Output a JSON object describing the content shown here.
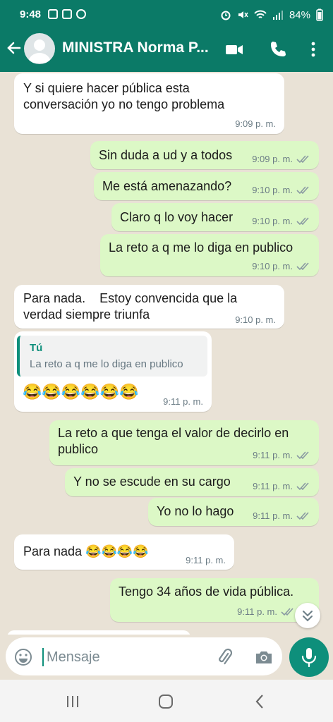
{
  "status_bar": {
    "time": "9:48",
    "battery": "84%"
  },
  "header": {
    "contact_name": "MINISTRA Norma P..."
  },
  "messages": [
    {
      "direction": "in",
      "text": "Y si quiere hacer pública esta conversación yo no tengo problema",
      "time": "9:09 p. m."
    },
    {
      "direction": "out",
      "text": "Sin duda a ud y a todos",
      "time": "9:09 p. m."
    },
    {
      "direction": "out",
      "text": "Me está amenazando?",
      "time": "9:10 p. m."
    },
    {
      "direction": "out",
      "text": "Claro q lo voy hacer",
      "time": "9:10 p. m."
    },
    {
      "direction": "out",
      "text": "La reto a q me lo diga en publico",
      "time": "9:10 p. m."
    },
    {
      "direction": "in",
      "text": "Para nada.    Estoy convencida que la verdad siempre triunfa",
      "time": "9:10 p. m."
    },
    {
      "direction": "in",
      "quote_author": "Tú",
      "quote_text": "La reto a q me lo diga en publico",
      "text": "😂😂😂😂😂😂",
      "time": "9:11 p. m."
    },
    {
      "direction": "out",
      "text": "La reto a que tenga el valor de decirlo en publico",
      "time": "9:11 p. m."
    },
    {
      "direction": "out",
      "text": "Y no se escude en su cargo",
      "time": "9:11 p. m."
    },
    {
      "direction": "out",
      "text": "Yo no lo hago",
      "time": "9:11 p. m."
    },
    {
      "direction": "in",
      "text": "Para nada 😂😂😂😂",
      "time": "9:11 p. m."
    },
    {
      "direction": "out",
      "text": "Tengo 34 años de vida pública.",
      "time": "9:11 p. m."
    }
  ],
  "composer": {
    "placeholder": "Mensaje"
  },
  "icons": {
    "back": "arrow-left-icon",
    "video": "video-call-icon",
    "call": "phone-icon",
    "menu": "more-vert-icon",
    "emoji": "emoji-icon",
    "attach": "paperclip-icon",
    "camera": "camera-icon",
    "mic": "mic-icon",
    "scroll": "chevron-double-down-icon",
    "read": "double-check-icon"
  },
  "colors": {
    "header": "#0b7a67",
    "outgoing_bubble": "#dcf8c6",
    "incoming_bubble": "#ffffff",
    "accent": "#0e8f7b",
    "chat_bg": "#e9e2d6"
  }
}
